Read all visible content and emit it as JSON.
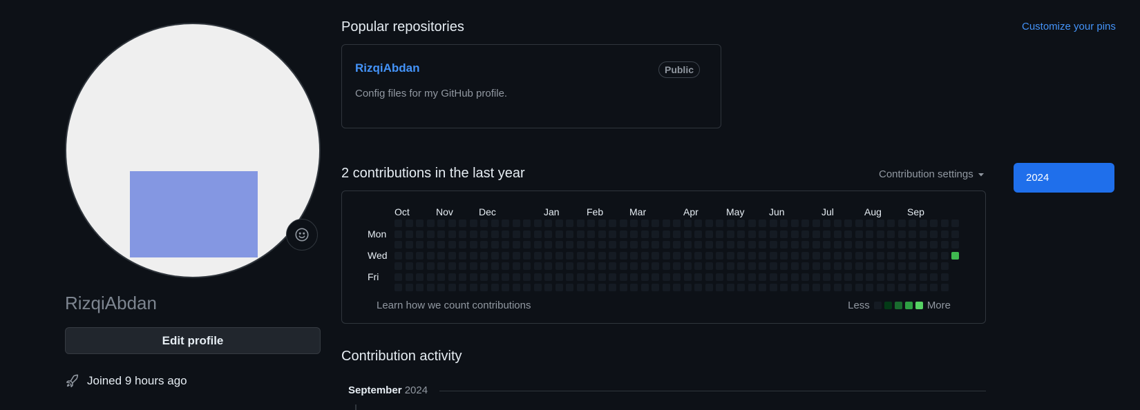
{
  "profile": {
    "username": "RizqiAbdan",
    "edit_label": "Edit profile",
    "joined_text": "Joined 9 hours ago"
  },
  "popular": {
    "title": "Popular repositories",
    "customize_label": "Customize your pins",
    "repo": {
      "name": "RizqiAbdan",
      "visibility": "Public",
      "description": "Config files for my GitHub profile."
    }
  },
  "contributions": {
    "title": "2 contributions in the last year",
    "settings_label": "Contribution settings",
    "months": [
      "Oct",
      "Nov",
      "Dec",
      "Jan",
      "Feb",
      "Mar",
      "Apr",
      "May",
      "Jun",
      "Jul",
      "Aug",
      "Sep"
    ],
    "days": [
      "Mon",
      "Wed",
      "Fri"
    ],
    "learn_label": "Learn how we count contributions",
    "legend_less": "Less",
    "legend_more": "More",
    "legend_colors": [
      "#151b23",
      "#033a16",
      "#196c2e",
      "#2ea043",
      "#56d364"
    ],
    "active_color": "#3fb950",
    "empty_color": "#151b23",
    "weeks": 53
  },
  "year_selector": {
    "selected": "2024"
  },
  "activity": {
    "title": "Contribution activity",
    "month": "September",
    "year": "2024"
  }
}
